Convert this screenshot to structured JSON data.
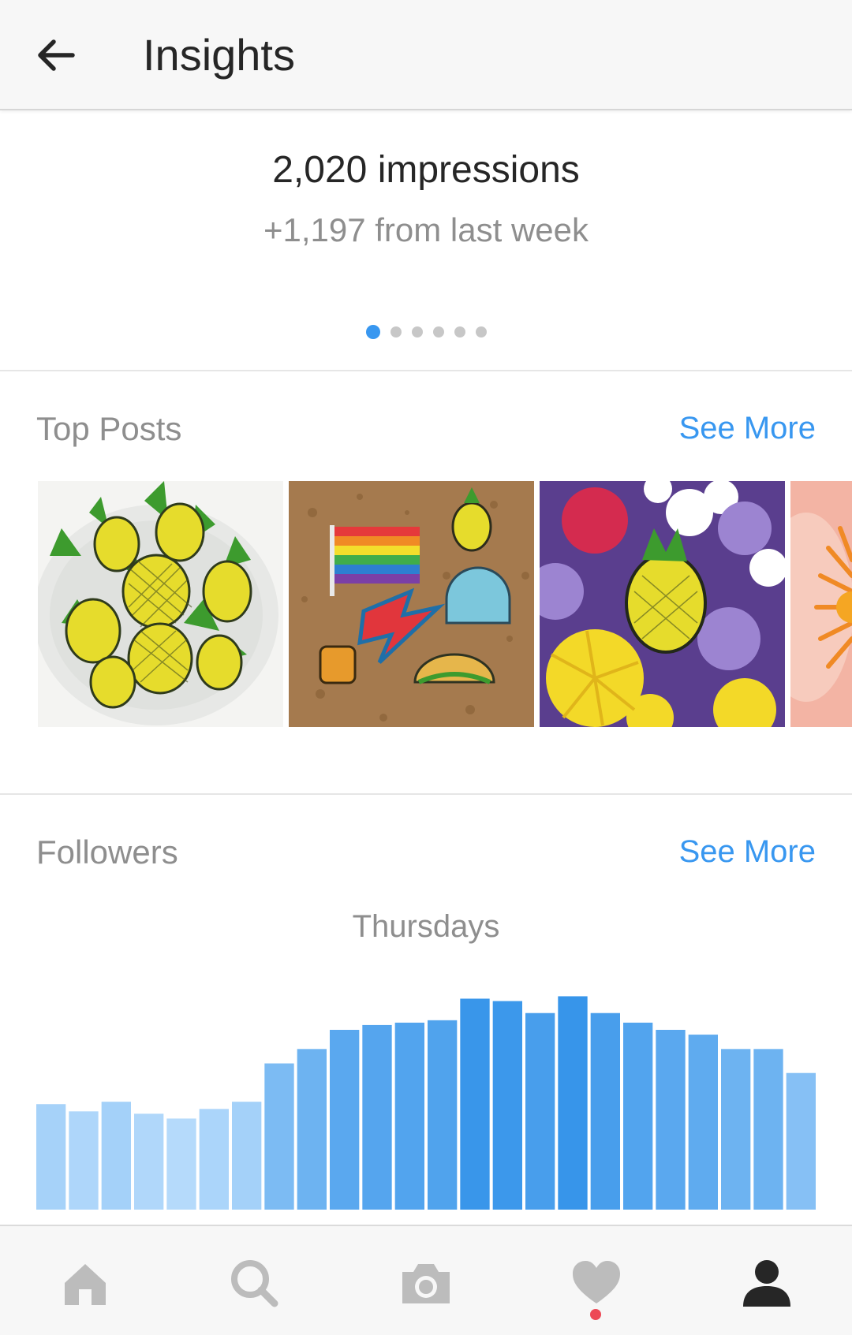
{
  "header": {
    "title": "Insights"
  },
  "impressions": {
    "headline": "2,020 impressions",
    "change": "+1,197 from last week",
    "pager": {
      "total": 6,
      "active_index": 0
    }
  },
  "top_posts": {
    "title": "Top Posts",
    "see_more": "See More"
  },
  "followers": {
    "title": "Followers",
    "see_more": "See More"
  },
  "chart_data": {
    "type": "bar",
    "title": "Thursdays",
    "xlabel": "",
    "ylabel": "",
    "categories": [
      "",
      "",
      "",
      "",
      "",
      "",
      "",
      "",
      "",
      "",
      "",
      "",
      "",
      "",
      "",
      "",
      "",
      "",
      "",
      "",
      "",
      "",
      "",
      ""
    ],
    "values": [
      44,
      41,
      45,
      40,
      38,
      42,
      45,
      61,
      67,
      75,
      77,
      78,
      79,
      88,
      87,
      82,
      89,
      82,
      78,
      75,
      73,
      67,
      67,
      57
    ],
    "ylim": [
      0,
      100
    ],
    "colors": {
      "low": "#b5dafb",
      "high": "#3795ea"
    }
  },
  "colors": {
    "accent": "#3897f0",
    "notification": "#ed4956",
    "text_primary": "#262626",
    "text_secondary": "#8e8e8e",
    "nav_inactive": "#bcbcbc",
    "nav_active": "#262626"
  },
  "bottom_nav": [
    {
      "icon": "home-icon",
      "active": false
    },
    {
      "icon": "search-icon",
      "active": false
    },
    {
      "icon": "camera-icon",
      "active": false
    },
    {
      "icon": "heart-icon",
      "active": false,
      "badge": true
    },
    {
      "icon": "profile-icon",
      "active": true
    }
  ]
}
